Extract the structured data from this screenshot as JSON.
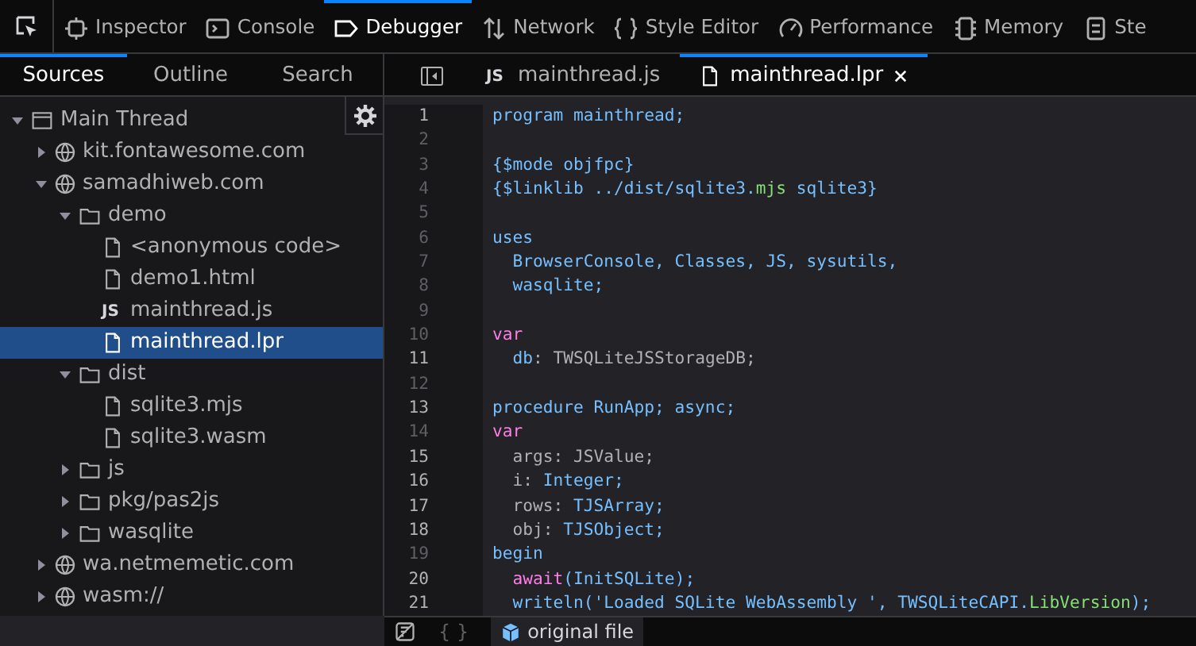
{
  "toolbar": {
    "tabs": [
      {
        "label": "Inspector",
        "selected": false
      },
      {
        "label": "Console",
        "selected": false
      },
      {
        "label": "Debugger",
        "selected": true
      },
      {
        "label": "Network",
        "selected": false
      },
      {
        "label": "Style Editor",
        "selected": false
      },
      {
        "label": "Performance",
        "selected": false
      },
      {
        "label": "Memory",
        "selected": false
      },
      {
        "label": "Ste",
        "selected": false
      }
    ]
  },
  "sidebar": {
    "tabs": [
      {
        "label": "Sources",
        "selected": true
      },
      {
        "label": "Outline",
        "selected": false
      },
      {
        "label": "Search",
        "selected": false
      }
    ],
    "tree": [
      {
        "label": "Main Thread",
        "kind": "thread",
        "expanded": true,
        "selected": false,
        "children": [
          {
            "label": "kit.fontawesome.com",
            "kind": "domain",
            "expanded": false,
            "selected": false
          },
          {
            "label": "samadhiweb.com",
            "kind": "domain",
            "expanded": true,
            "selected": false,
            "children": [
              {
                "label": "demo",
                "kind": "folder",
                "expanded": true,
                "selected": false,
                "children": [
                  {
                    "label": "<anonymous code>",
                    "kind": "file",
                    "selected": false
                  },
                  {
                    "label": "demo1.html",
                    "kind": "file",
                    "selected": false
                  },
                  {
                    "label": "mainthread.js",
                    "kind": "js",
                    "badge": "JS",
                    "selected": false
                  },
                  {
                    "label": "mainthread.lpr",
                    "kind": "file",
                    "selected": true
                  }
                ]
              },
              {
                "label": "dist",
                "kind": "folder",
                "expanded": true,
                "selected": false,
                "children": [
                  {
                    "label": "sqlite3.mjs",
                    "kind": "file",
                    "selected": false
                  },
                  {
                    "label": "sqlite3.wasm",
                    "kind": "file",
                    "selected": false
                  }
                ]
              },
              {
                "label": "js",
                "kind": "folder",
                "expanded": false,
                "selected": false
              },
              {
                "label": "pkg/pas2js",
                "kind": "folder",
                "expanded": false,
                "selected": false
              },
              {
                "label": "wasqlite",
                "kind": "folder",
                "expanded": false,
                "selected": false
              }
            ]
          },
          {
            "label": "wa.netmemetic.com",
            "kind": "domain",
            "expanded": false,
            "selected": false
          },
          {
            "label": "wasm://",
            "kind": "domain",
            "expanded": false,
            "selected": false
          }
        ]
      }
    ]
  },
  "editor": {
    "tabs": [
      {
        "label": "mainthread.js",
        "kind": "js",
        "badge": "JS",
        "selected": false,
        "closable": false
      },
      {
        "label": "mainthread.lpr",
        "kind": "file",
        "selected": true,
        "closable": true
      }
    ],
    "lines": [
      {
        "number": "1",
        "executable": true,
        "tokens": [
          {
            "text": "program mainthread;",
            "kind": "plain"
          }
        ]
      },
      {
        "number": "2",
        "executable": false
      },
      {
        "number": "3",
        "executable": false,
        "tokens": [
          {
            "text": "{$mode objfpc}",
            "kind": "plain"
          }
        ]
      },
      {
        "number": "4",
        "executable": false,
        "tokens": [
          {
            "text": "{$linklib ../dist/sqlite3.",
            "kind": "plain"
          },
          {
            "text": "mjs",
            "kind": "prop"
          },
          {
            "text": " sqlite3}",
            "kind": "plain"
          }
        ]
      },
      {
        "number": "5",
        "executable": false
      },
      {
        "number": "6",
        "executable": false,
        "tokens": [
          {
            "text": "uses",
            "kind": "plain"
          }
        ]
      },
      {
        "number": "7",
        "executable": false,
        "tokens": [
          {
            "text": "  BrowserConsole, Classes, JS, sysutils,",
            "kind": "plain"
          }
        ]
      },
      {
        "number": "8",
        "executable": false,
        "tokens": [
          {
            "text": "  wasqlite;",
            "kind": "plain"
          }
        ]
      },
      {
        "number": "9",
        "executable": false
      },
      {
        "number": "10",
        "executable": false,
        "tokens": [
          {
            "text": "var",
            "kind": "keyword"
          }
        ]
      },
      {
        "number": "11",
        "executable": true,
        "tokens": [
          {
            "text": "  db",
            "kind": "plain"
          },
          {
            "text": ": TWSQLiteJSStorageDB;",
            "kind": "ident"
          }
        ]
      },
      {
        "number": "12",
        "executable": false
      },
      {
        "number": "13",
        "executable": true,
        "tokens": [
          {
            "text": "procedure RunApp; async;",
            "kind": "plain"
          }
        ]
      },
      {
        "number": "14",
        "executable": false,
        "tokens": [
          {
            "text": "var",
            "kind": "keyword"
          }
        ]
      },
      {
        "number": "15",
        "executable": true,
        "tokens": [
          {
            "text": "  args: JSValue;",
            "kind": "ident"
          }
        ]
      },
      {
        "number": "16",
        "executable": true,
        "tokens": [
          {
            "text": "  i: ",
            "kind": "ident"
          },
          {
            "text": "Integer;",
            "kind": "plain"
          }
        ]
      },
      {
        "number": "17",
        "executable": true,
        "tokens": [
          {
            "text": "  rows: ",
            "kind": "ident"
          },
          {
            "text": "TJSArray;",
            "kind": "plain"
          }
        ]
      },
      {
        "number": "18",
        "executable": true,
        "tokens": [
          {
            "text": "  obj: ",
            "kind": "ident"
          },
          {
            "text": "TJSObject;",
            "kind": "plain"
          }
        ]
      },
      {
        "number": "19",
        "executable": false,
        "tokens": [
          {
            "text": "begin",
            "kind": "plain"
          }
        ]
      },
      {
        "number": "20",
        "executable": true,
        "tokens": [
          {
            "text": "  await",
            "kind": "keyword"
          },
          {
            "text": "(InitSQLite);",
            "kind": "plain"
          }
        ]
      },
      {
        "number": "21",
        "executable": true,
        "tokens": [
          {
            "text": "  writeln('Loaded SQLite WebAssembly ', TWSQLiteCAPI.",
            "kind": "plain"
          },
          {
            "text": "LibVersion",
            "kind": "prop"
          },
          {
            "text": ");",
            "kind": "plain"
          }
        ]
      }
    ]
  },
  "footer": {
    "pretty_print": "{ }",
    "source_label": "original file"
  }
}
